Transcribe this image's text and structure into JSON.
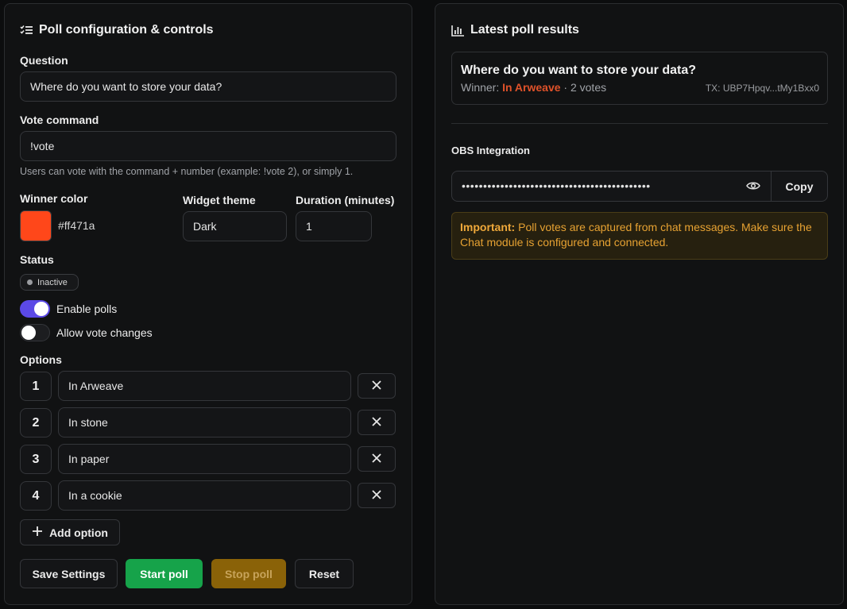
{
  "config": {
    "title": "Poll configuration & controls",
    "question_label": "Question",
    "question_value": "Where do you want to store your data?",
    "vote_command_label": "Vote command",
    "vote_command_value": "!vote",
    "vote_help": "Users can vote with the command + number (example: !vote 2), or simply 1.",
    "winner_color_label": "Winner color",
    "winner_color_hex": "#ff471a",
    "widget_theme_label": "Widget theme",
    "widget_theme_value": "Dark",
    "duration_label": "Duration (minutes)",
    "duration_value": "1",
    "status_label": "Status",
    "status_badge": "Inactive",
    "enable_polls_label": "Enable polls",
    "enable_polls_on": true,
    "allow_changes_label": "Allow vote changes",
    "allow_changes_on": false,
    "options_label": "Options",
    "options": [
      {
        "num": "1",
        "value": "In Arweave"
      },
      {
        "num": "2",
        "value": "In stone"
      },
      {
        "num": "3",
        "value": "In paper"
      },
      {
        "num": "4",
        "value": "In a cookie"
      }
    ],
    "add_option_label": "Add option",
    "buttons": {
      "save": "Save Settings",
      "start": "Start poll",
      "stop": "Stop poll",
      "reset": "Reset"
    }
  },
  "results": {
    "title": "Latest poll results",
    "question": "Where do you want to store your data?",
    "winner_prefix": "Winner:",
    "winner": "In Arweave",
    "votes": "· 2 votes",
    "tx": "TX: UBP7Hpqv...tMy1Bxx0",
    "obs_label": "OBS Integration",
    "obs_masked": "••••••••••••••••••••••••••••••••••••••••••••",
    "copy_label": "Copy",
    "notice_strong": "Important:",
    "notice_text": "Poll votes are captured from chat messages. Make sure the Chat module is configured and connected."
  },
  "colors": {
    "accent": "#5b49e6",
    "start_green": "#16a34a",
    "stop_amber": "#8a6208",
    "winner_color": "#ff471a",
    "winner_text": "#e0522a"
  },
  "icons": [
    "list-settings-icon",
    "bar-chart-icon",
    "close-icon",
    "plus-icon",
    "eye-icon",
    "status-dot-icon"
  ]
}
